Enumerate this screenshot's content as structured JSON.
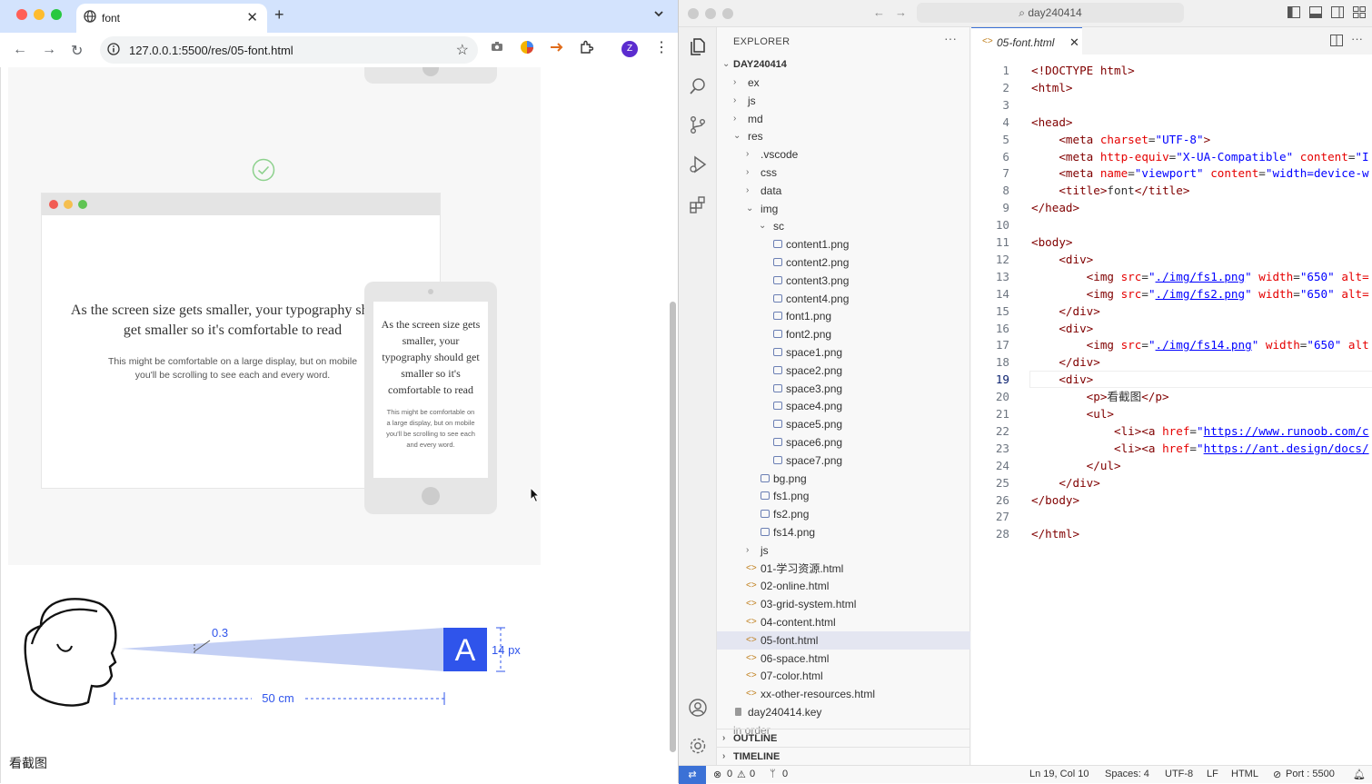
{
  "browser": {
    "tab_title": "font",
    "new_tab": "+",
    "url": "127.0.0.1:5500/res/05-font.html",
    "avatar_letter": "Z"
  },
  "page": {
    "big_text": "As the screen size gets smaller, your typography should get smaller so it's comfortable to read",
    "small_text": "This might be comfortable on a large display, but on mobile you'll be scrolling to see each and every word.",
    "phone_big_text": "As the screen size gets smaller, your typography should get smaller so it's comfortable to read",
    "phone_small_text": "This might be comfortable on a large display, but on mobile you'll be scrolling to see each and every word.",
    "diagram_angle": "0.3",
    "diagram_size": "14 px",
    "diagram_distance": "50 cm",
    "diagram_letter": "A",
    "caption": "看截图"
  },
  "vscode": {
    "command_center": "day240414",
    "explorer_title": "EXPLORER",
    "root": "DAY240414",
    "tree": [
      {
        "label": "ex",
        "kind": "folder",
        "depth": 0,
        "open": false
      },
      {
        "label": "js",
        "kind": "folder",
        "depth": 0,
        "open": false
      },
      {
        "label": "md",
        "kind": "folder",
        "depth": 0,
        "open": false
      },
      {
        "label": "res",
        "kind": "folder",
        "depth": 0,
        "open": true
      },
      {
        "label": ".vscode",
        "kind": "folder",
        "depth": 1,
        "open": false
      },
      {
        "label": "css",
        "kind": "folder",
        "depth": 1,
        "open": false
      },
      {
        "label": "data",
        "kind": "folder",
        "depth": 1,
        "open": false
      },
      {
        "label": "img",
        "kind": "folder",
        "depth": 1,
        "open": true
      },
      {
        "label": "sc",
        "kind": "folder",
        "depth": 2,
        "open": true
      },
      {
        "label": "content1.png",
        "kind": "img",
        "depth": 3
      },
      {
        "label": "content2.png",
        "kind": "img",
        "depth": 3
      },
      {
        "label": "content3.png",
        "kind": "img",
        "depth": 3
      },
      {
        "label": "content4.png",
        "kind": "img",
        "depth": 3
      },
      {
        "label": "font1.png",
        "kind": "img",
        "depth": 3
      },
      {
        "label": "font2.png",
        "kind": "img",
        "depth": 3
      },
      {
        "label": "space1.png",
        "kind": "img",
        "depth": 3
      },
      {
        "label": "space2.png",
        "kind": "img",
        "depth": 3
      },
      {
        "label": "space3.png",
        "kind": "img",
        "depth": 3
      },
      {
        "label": "space4.png",
        "kind": "img",
        "depth": 3
      },
      {
        "label": "space5.png",
        "kind": "img",
        "depth": 3
      },
      {
        "label": "space6.png",
        "kind": "img",
        "depth": 3
      },
      {
        "label": "space7.png",
        "kind": "img",
        "depth": 3
      },
      {
        "label": "bg.png",
        "kind": "img",
        "depth": 2
      },
      {
        "label": "fs1.png",
        "kind": "img",
        "depth": 2
      },
      {
        "label": "fs2.png",
        "kind": "img",
        "depth": 2
      },
      {
        "label": "fs14.png",
        "kind": "img",
        "depth": 2
      },
      {
        "label": "js",
        "kind": "folder",
        "depth": 1,
        "open": false
      },
      {
        "label": "01-学习资源.html",
        "kind": "html",
        "depth": 1
      },
      {
        "label": "02-online.html",
        "kind": "html",
        "depth": 1
      },
      {
        "label": "03-grid-system.html",
        "kind": "html",
        "depth": 1
      },
      {
        "label": "04-content.html",
        "kind": "html",
        "depth": 1
      },
      {
        "label": "05-font.html",
        "kind": "html",
        "depth": 1,
        "selected": true
      },
      {
        "label": "06-space.html",
        "kind": "html",
        "depth": 1
      },
      {
        "label": "07-color.html",
        "kind": "html",
        "depth": 1
      },
      {
        "label": "xx-other-resources.html",
        "kind": "html",
        "depth": 1
      },
      {
        "label": "day240414.key",
        "kind": "key",
        "depth": 0
      },
      {
        "label": "in order",
        "kind": "none",
        "depth": 0
      }
    ],
    "outline": "OUTLINE",
    "timeline": "TIMELINE",
    "editor_tab": "05-font.html",
    "code_lines": [
      [
        [
          "t",
          "<!DOCTYPE html>"
        ]
      ],
      [
        [
          "t",
          "<html>"
        ]
      ],
      [],
      [
        [
          "t",
          "<head>"
        ]
      ],
      [
        [
          "k",
          "    "
        ],
        [
          "t",
          "<meta "
        ],
        [
          "a",
          "charset"
        ],
        [
          "k",
          "="
        ],
        [
          "s",
          "\"UTF-8\""
        ],
        [
          "t",
          ">"
        ]
      ],
      [
        [
          "k",
          "    "
        ],
        [
          "t",
          "<meta "
        ],
        [
          "a",
          "http-equiv"
        ],
        [
          "k",
          "="
        ],
        [
          "s",
          "\"X-UA-Compatible\""
        ],
        [
          "k",
          " "
        ],
        [
          "a",
          "content"
        ],
        [
          "k",
          "="
        ],
        [
          "s",
          "\"I"
        ]
      ],
      [
        [
          "k",
          "    "
        ],
        [
          "t",
          "<meta "
        ],
        [
          "a",
          "name"
        ],
        [
          "k",
          "="
        ],
        [
          "s",
          "\"viewport\""
        ],
        [
          "k",
          " "
        ],
        [
          "a",
          "content"
        ],
        [
          "k",
          "="
        ],
        [
          "s",
          "\"width=device-w"
        ]
      ],
      [
        [
          "k",
          "    "
        ],
        [
          "t",
          "<title>"
        ],
        [
          "k",
          "font"
        ],
        [
          "t",
          "</title>"
        ]
      ],
      [
        [
          "t",
          "</head>"
        ]
      ],
      [],
      [
        [
          "t",
          "<body>"
        ]
      ],
      [
        [
          "k",
          "    "
        ],
        [
          "t",
          "<div>"
        ]
      ],
      [
        [
          "k",
          "        "
        ],
        [
          "t",
          "<img "
        ],
        [
          "a",
          "src"
        ],
        [
          "k",
          "="
        ],
        [
          "s",
          "\""
        ],
        [
          "u",
          "./img/fs1.png"
        ],
        [
          "s",
          "\""
        ],
        [
          "k",
          " "
        ],
        [
          "a",
          "width"
        ],
        [
          "k",
          "="
        ],
        [
          "s",
          "\"650\""
        ],
        [
          "k",
          " "
        ],
        [
          "a",
          "alt="
        ]
      ],
      [
        [
          "k",
          "        "
        ],
        [
          "t",
          "<img "
        ],
        [
          "a",
          "src"
        ],
        [
          "k",
          "="
        ],
        [
          "s",
          "\""
        ],
        [
          "u",
          "./img/fs2.png"
        ],
        [
          "s",
          "\""
        ],
        [
          "k",
          " "
        ],
        [
          "a",
          "width"
        ],
        [
          "k",
          "="
        ],
        [
          "s",
          "\"650\""
        ],
        [
          "k",
          " "
        ],
        [
          "a",
          "alt="
        ]
      ],
      [
        [
          "k",
          "    "
        ],
        [
          "t",
          "</div>"
        ]
      ],
      [
        [
          "k",
          "    "
        ],
        [
          "t",
          "<div>"
        ]
      ],
      [
        [
          "k",
          "        "
        ],
        [
          "t",
          "<img "
        ],
        [
          "a",
          "src"
        ],
        [
          "k",
          "="
        ],
        [
          "s",
          "\""
        ],
        [
          "u",
          "./img/fs14.png"
        ],
        [
          "s",
          "\""
        ],
        [
          "k",
          " "
        ],
        [
          "a",
          "width"
        ],
        [
          "k",
          "="
        ],
        [
          "s",
          "\"650\""
        ],
        [
          "k",
          " "
        ],
        [
          "a",
          "alt"
        ]
      ],
      [
        [
          "k",
          "    "
        ],
        [
          "t",
          "</div>"
        ]
      ],
      [
        [
          "k",
          "    "
        ],
        [
          "t",
          "<div>"
        ]
      ],
      [
        [
          "k",
          "        "
        ],
        [
          "t",
          "<p>"
        ],
        [
          "k",
          "看截图"
        ],
        [
          "t",
          "</p>"
        ]
      ],
      [
        [
          "k",
          "        "
        ],
        [
          "t",
          "<ul>"
        ]
      ],
      [
        [
          "k",
          "            "
        ],
        [
          "t",
          "<li><a "
        ],
        [
          "a",
          "href"
        ],
        [
          "k",
          "="
        ],
        [
          "s",
          "\""
        ],
        [
          "u",
          "https://www.runoob.com/c"
        ]
      ],
      [
        [
          "k",
          "            "
        ],
        [
          "t",
          "<li><a "
        ],
        [
          "a",
          "href"
        ],
        [
          "k",
          "="
        ],
        [
          "s",
          "\""
        ],
        [
          "u",
          "https://ant.design/docs/"
        ]
      ],
      [
        [
          "k",
          "        "
        ],
        [
          "t",
          "</ul>"
        ]
      ],
      [
        [
          "k",
          "    "
        ],
        [
          "t",
          "</div>"
        ]
      ],
      [
        [
          "t",
          "</body>"
        ]
      ],
      [],
      [
        [
          "t",
          "</html>"
        ]
      ]
    ],
    "current_line": 19,
    "status": {
      "errors": "0",
      "warnings": "0",
      "ports": "0",
      "position": "Ln 19, Col 10",
      "spaces": "Spaces: 4",
      "encoding": "UTF-8",
      "eol": "LF",
      "language": "HTML",
      "port": "Port : 5500"
    }
  }
}
